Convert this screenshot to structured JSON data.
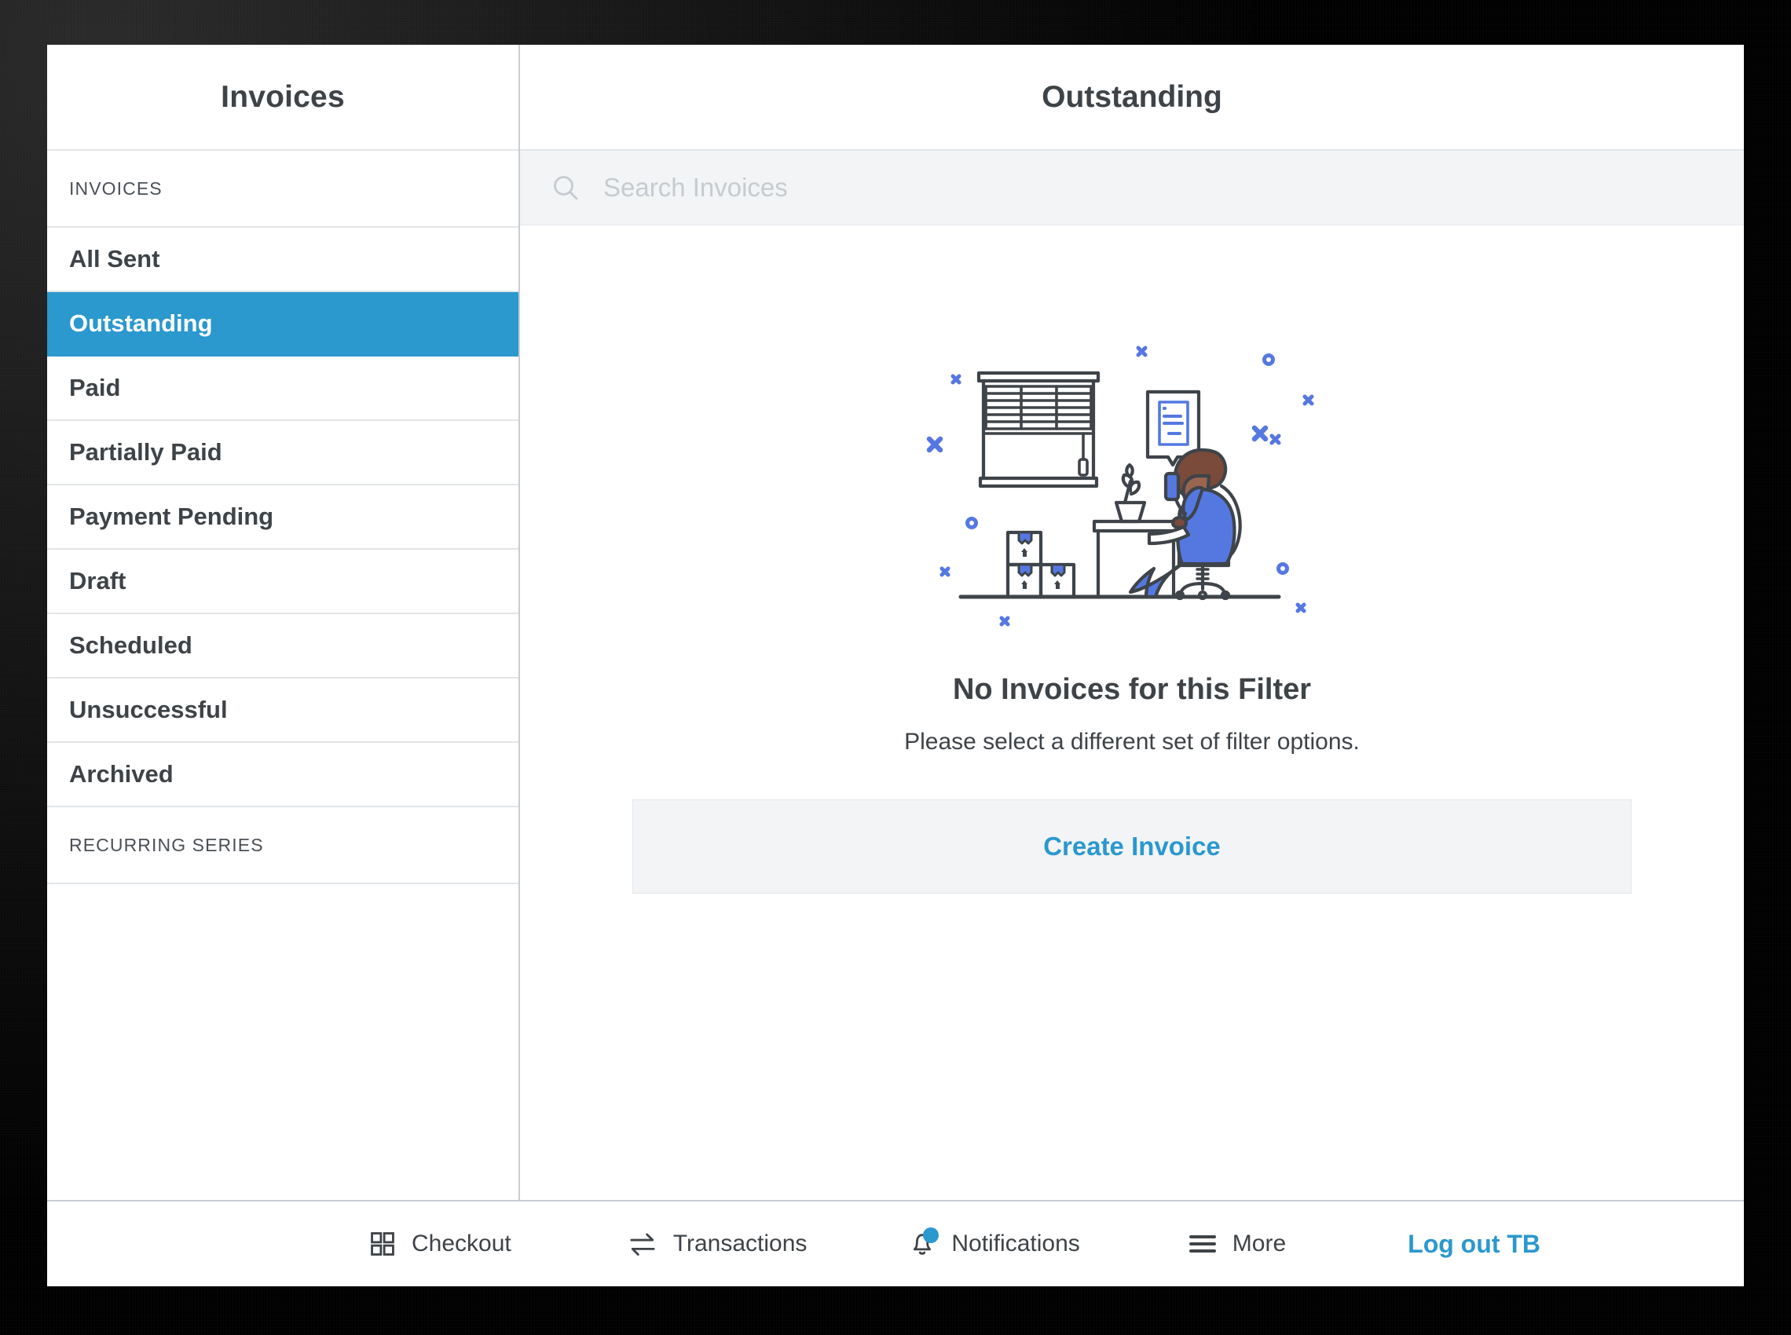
{
  "window": {
    "sidebar": {
      "title": "Invoices",
      "section_label": "INVOICES",
      "items": [
        {
          "label": "All Sent",
          "selected": false
        },
        {
          "label": "Outstanding",
          "selected": true
        },
        {
          "label": "Paid",
          "selected": false
        },
        {
          "label": "Partially Paid",
          "selected": false
        },
        {
          "label": "Payment Pending",
          "selected": false
        },
        {
          "label": "Draft",
          "selected": false
        },
        {
          "label": "Scheduled",
          "selected": false
        },
        {
          "label": "Unsuccessful",
          "selected": false
        },
        {
          "label": "Archived",
          "selected": false
        }
      ],
      "section_label_2": "RECURRING SERIES"
    },
    "main": {
      "title": "Outstanding",
      "search": {
        "placeholder": "Search Invoices",
        "value": "",
        "icon": "search-icon"
      },
      "empty_state": {
        "illustration": "person-at-desk-illustration",
        "heading": "No Invoices for this Filter",
        "subtext": "Please select a different set of filter options.",
        "action_label": "Create Invoice"
      }
    },
    "bottom_nav": {
      "items": [
        {
          "label": "Checkout",
          "icon": "grid-icon",
          "badge": false
        },
        {
          "label": "Transactions",
          "icon": "transfer-arrows-icon",
          "badge": false
        },
        {
          "label": "Notifications",
          "icon": "bell-icon",
          "badge": true
        },
        {
          "label": "More",
          "icon": "hamburger-icon",
          "badge": false
        }
      ],
      "logout_label": "Log out TB"
    }
  },
  "colors": {
    "accent_blue": "#2b98ce",
    "text_dark": "#3e4347",
    "illustration_blue": "#5578e0",
    "illustration_outline": "#3e4449",
    "illustration_skin": "#7a4a3a",
    "search_bg": "#f2f4f6",
    "divider": "#e2e5e8"
  }
}
